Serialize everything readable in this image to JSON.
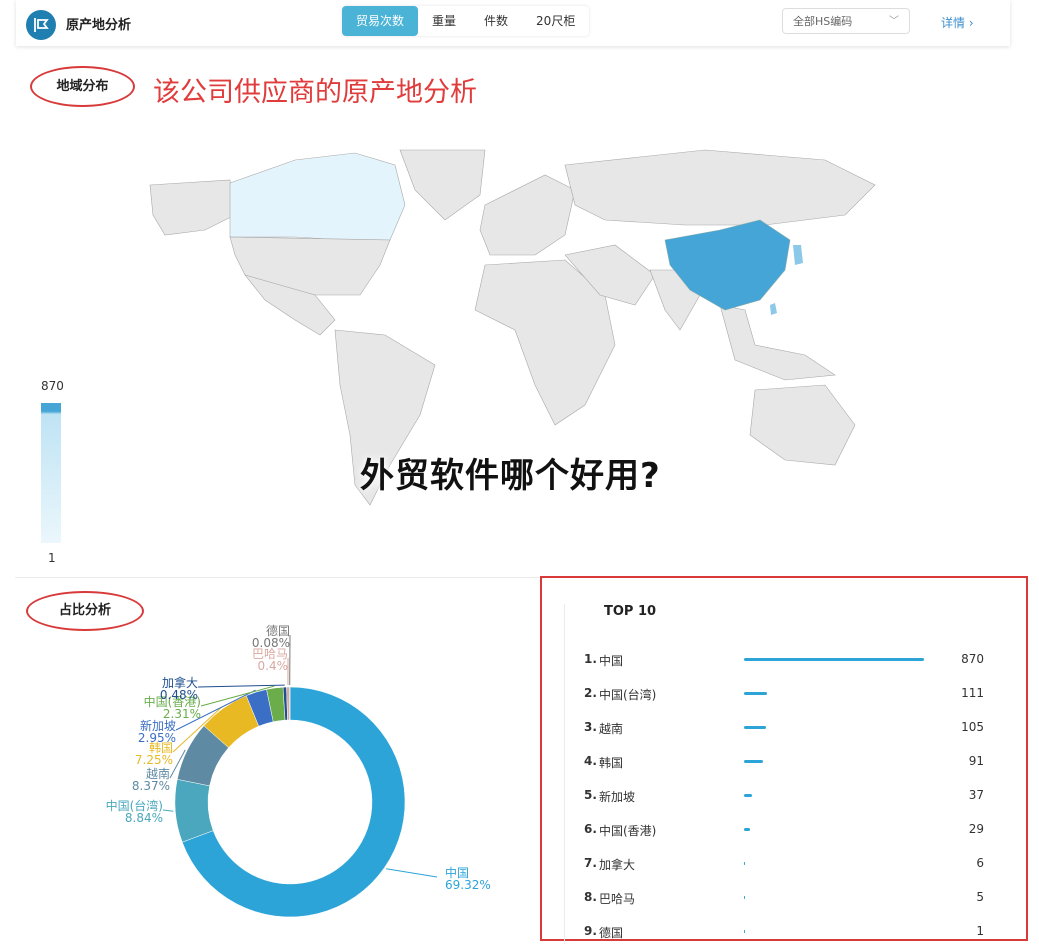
{
  "header": {
    "title": "原产地分析",
    "tabs": [
      {
        "label": "贸易次数",
        "active": true
      },
      {
        "label": "重量",
        "active": false
      },
      {
        "label": "件数",
        "active": false
      },
      {
        "label": "20尺柜",
        "active": false
      }
    ],
    "hs_select": "全部HS编码",
    "detail_link": "详情 ›"
  },
  "map_section": {
    "title": "地域分布",
    "annotation": "该公司供应商的原产地分析",
    "legend_max": "870",
    "legend_min": "1",
    "highlight_color": "#44a5d6"
  },
  "overlay_text": "外贸软件哪个好用?",
  "share_section": {
    "title": "占比分析",
    "slices": [
      {
        "name": "中国",
        "pct": 69.32,
        "label": "69.32%",
        "color": "#2ca4d8"
      },
      {
        "name": "中国(台湾)",
        "pct": 8.84,
        "label": "8.84%",
        "color": "#4aa7bd"
      },
      {
        "name": "越南",
        "pct": 8.37,
        "label": "8.37%",
        "color": "#5f8aa3"
      },
      {
        "name": "韩国",
        "pct": 7.25,
        "label": "7.25%",
        "color": "#e8b923"
      },
      {
        "name": "新加坡",
        "pct": 2.95,
        "label": "2.95%",
        "color": "#3b6fc5"
      },
      {
        "name": "中国(香港)",
        "pct": 2.31,
        "label": "2.31%",
        "color": "#6aad4a"
      },
      {
        "name": "加拿大",
        "pct": 0.48,
        "label": "0.48%",
        "color": "#1f4f8f"
      },
      {
        "name": "巴哈马",
        "pct": 0.4,
        "label": "0.4%",
        "color": "#d9a8a0"
      },
      {
        "name": "德国",
        "pct": 0.08,
        "label": "0.08%",
        "color": "#777777"
      }
    ]
  },
  "top10": {
    "title": "TOP 10",
    "max": 870,
    "rows": [
      {
        "rank": "1.",
        "name": "中国",
        "value": 870
      },
      {
        "rank": "2.",
        "name": "中国(台湾)",
        "value": 111
      },
      {
        "rank": "3.",
        "name": "越南",
        "value": 105
      },
      {
        "rank": "4.",
        "name": "韩国",
        "value": 91
      },
      {
        "rank": "5.",
        "name": "新加坡",
        "value": 37
      },
      {
        "rank": "6.",
        "name": "中国(香港)",
        "value": 29
      },
      {
        "rank": "7.",
        "name": "加拿大",
        "value": 6
      },
      {
        "rank": "8.",
        "name": "巴哈马",
        "value": 5
      },
      {
        "rank": "9.",
        "name": "德国",
        "value": 1
      }
    ]
  },
  "chart_data": {
    "type": "pie",
    "categories": [
      "中国",
      "中国(台湾)",
      "越南",
      "韩国",
      "新加坡",
      "中国(香港)",
      "加拿大",
      "巴哈马",
      "德国"
    ],
    "values": [
      69.32,
      8.84,
      8.37,
      7.25,
      2.95,
      2.31,
      0.48,
      0.4,
      0.08
    ],
    "title": "占比分析"
  }
}
